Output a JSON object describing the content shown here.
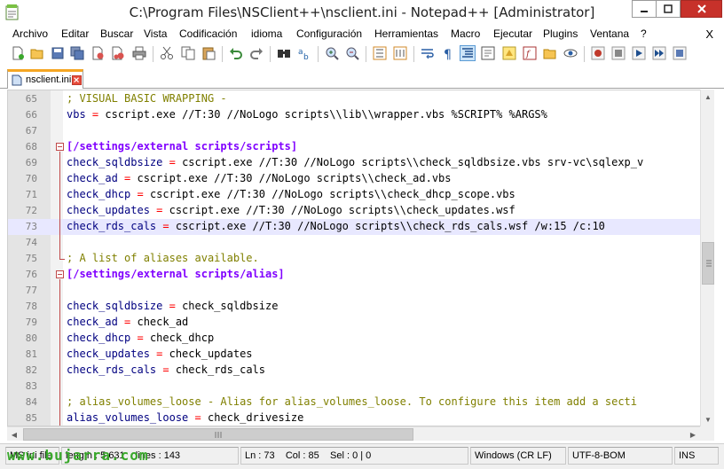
{
  "window": {
    "title": "C:\\Program Files\\NSClient++\\nsclient.ini - Notepad++ [Administrator]",
    "controls": [
      "minimize",
      "maximize",
      "close"
    ]
  },
  "menu": {
    "items": [
      "Archivo",
      "Editar",
      "Buscar",
      "Vista",
      "Codificación",
      "idioma",
      "Configuración",
      "Herramientas",
      "Macro",
      "Ejecutar",
      "Plugins",
      "Ventana",
      "?"
    ],
    "close_doc": "X"
  },
  "tabs": [
    {
      "label": "nsclient.ini",
      "active": true
    }
  ],
  "editor": {
    "current_line": 73,
    "lines": [
      {
        "num": "65",
        "tokens": [
          {
            "t": "; VISUAL BASIC WRAPPING -",
            "k": "comment"
          }
        ]
      },
      {
        "num": "66",
        "tokens": [
          {
            "t": "vbs",
            "k": "key"
          },
          {
            "t": " = ",
            "k": "eq"
          },
          {
            "t": "cscript.exe //T:30 //NoLogo scripts\\\\lib\\\\wrapper.vbs %SCRIPT% %ARGS%",
            "k": "val"
          }
        ]
      },
      {
        "num": "67",
        "tokens": []
      },
      {
        "num": "68",
        "fold": "open",
        "tokens": [
          {
            "t": "[/settings/external scripts/scripts]",
            "k": "section"
          }
        ]
      },
      {
        "num": "69",
        "tokens": [
          {
            "t": "check_sqldbsize",
            "k": "key"
          },
          {
            "t": " = ",
            "k": "eq"
          },
          {
            "t": "cscript.exe //T:30 //NoLogo scripts\\\\check_sqldbsize.vbs srv-vc\\sqlexp_v",
            "k": "val"
          }
        ]
      },
      {
        "num": "70",
        "tokens": [
          {
            "t": "check_ad",
            "k": "key"
          },
          {
            "t": " = ",
            "k": "eq"
          },
          {
            "t": "cscript.exe //T:30 //NoLogo scripts\\\\check_ad.vbs",
            "k": "val"
          }
        ]
      },
      {
        "num": "71",
        "tokens": [
          {
            "t": "check_dhcp",
            "k": "key"
          },
          {
            "t": " = ",
            "k": "eq"
          },
          {
            "t": "cscript.exe //T:30 //NoLogo scripts\\\\check_dhcp_scope.vbs",
            "k": "val"
          }
        ]
      },
      {
        "num": "72",
        "tokens": [
          {
            "t": "check_updates",
            "k": "key"
          },
          {
            "t": " = ",
            "k": "eq"
          },
          {
            "t": "cscript.exe //T:30 //NoLogo scripts\\\\check_updates.wsf",
            "k": "val"
          }
        ]
      },
      {
        "num": "73",
        "tokens": [
          {
            "t": "check_rds_cals",
            "k": "key"
          },
          {
            "t": " = ",
            "k": "eq"
          },
          {
            "t": "cscript.exe //T:30 //NoLogo scripts\\\\check_rds_cals.wsf /w:15 /c:10",
            "k": "val"
          }
        ]
      },
      {
        "num": "74",
        "tokens": []
      },
      {
        "num": "75",
        "fold": "end",
        "tokens": [
          {
            "t": "; A list of aliases available.",
            "k": "comment"
          }
        ]
      },
      {
        "num": "76",
        "fold": "open",
        "tokens": [
          {
            "t": "[/settings/external scripts/alias]",
            "k": "section"
          }
        ]
      },
      {
        "num": "77",
        "tokens": []
      },
      {
        "num": "78",
        "tokens": [
          {
            "t": "check_sqldbsize",
            "k": "key"
          },
          {
            "t": " = ",
            "k": "eq"
          },
          {
            "t": "check_sqldbsize",
            "k": "val"
          }
        ]
      },
      {
        "num": "79",
        "tokens": [
          {
            "t": "check_ad",
            "k": "key"
          },
          {
            "t": " = ",
            "k": "eq"
          },
          {
            "t": "check_ad",
            "k": "val"
          }
        ]
      },
      {
        "num": "80",
        "tokens": [
          {
            "t": "check_dhcp",
            "k": "key"
          },
          {
            "t": " = ",
            "k": "eq"
          },
          {
            "t": "check_dhcp",
            "k": "val"
          }
        ]
      },
      {
        "num": "81",
        "tokens": [
          {
            "t": "check_updates",
            "k": "key"
          },
          {
            "t": " = ",
            "k": "eq"
          },
          {
            "t": "check_updates",
            "k": "val"
          }
        ]
      },
      {
        "num": "82",
        "tokens": [
          {
            "t": "check_rds_cals",
            "k": "key"
          },
          {
            "t": " = ",
            "k": "eq"
          },
          {
            "t": "check_rds_cals",
            "k": "val"
          }
        ]
      },
      {
        "num": "83",
        "tokens": []
      },
      {
        "num": "84",
        "tokens": [
          {
            "t": "; alias_volumes_loose - Alias for alias_volumes_loose. To configure this item add a secti",
            "k": "comment"
          }
        ]
      },
      {
        "num": "85",
        "tokens": [
          {
            "t": "alias_volumes_loose",
            "k": "key"
          },
          {
            "t": " = ",
            "k": "eq"
          },
          {
            "t": "check_drivesize",
            "k": "val"
          }
        ]
      }
    ]
  },
  "status": {
    "file_type": "MS ini file",
    "length": "length : 5.631",
    "lines": "lines : 143",
    "position": "Ln : 73    Col : 85    Sel : 0 | 0",
    "eol": "Windows (CR LF)",
    "encoding": "UTF-8-BOM",
    "mode": "INS"
  },
  "watermark": "www.bujarra.com",
  "colors": {
    "comment": "#808000",
    "section": "#8000ff",
    "key": "#000080",
    "eq": "#ff0000",
    "current_line_bg": "#e8e8ff",
    "tab_accent": "#f5a623"
  }
}
